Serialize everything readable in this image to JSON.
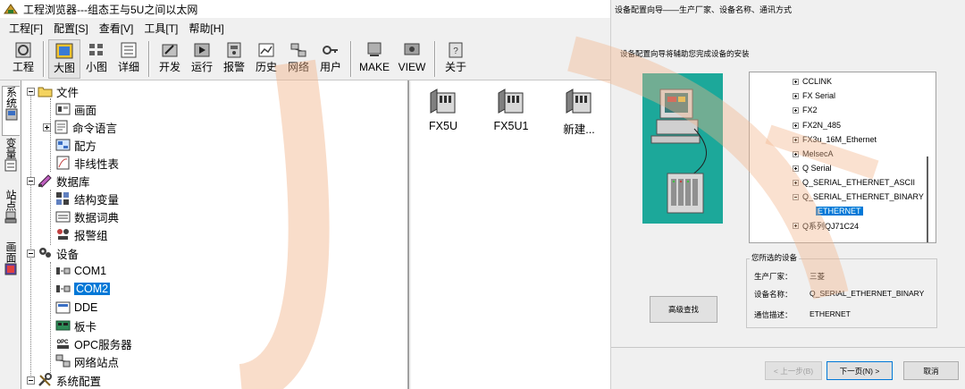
{
  "window": {
    "title": "工程浏览器---组态王与5U之间以太网"
  },
  "menu": [
    "工程[F]",
    "配置[S]",
    "查看[V]",
    "工具[T]",
    "帮助[H]"
  ],
  "toolbar": {
    "project": "工程",
    "large_icon": "大图",
    "small_icon": "小图",
    "details": "详细",
    "develop": "开发",
    "run": "运行",
    "alarm": "报警",
    "history": "历史",
    "network": "网络",
    "user": "用户",
    "make": "MAKE",
    "view": "VIEW",
    "about": "关于"
  },
  "side_tabs": [
    "系统",
    "变量",
    "站点",
    "画面"
  ],
  "tree": {
    "file": "文件",
    "screen": "画面",
    "command_lang": "命令语言",
    "recipe": "配方",
    "nonlinear": "非线性表",
    "database": "数据库",
    "struct_var": "结构变量",
    "data_dict": "数据词典",
    "alarm_group": "报警组",
    "device": "设备",
    "com1": "COM1",
    "com2": "COM2",
    "dde": "DDE",
    "board": "板卡",
    "opc": "OPC服务器",
    "net_station": "网络站点",
    "sys_config": "系统配置"
  },
  "list_items": [
    "FX5U",
    "FX5U1",
    "新建..."
  ],
  "dialog": {
    "title": "设备配置向导——生产厂家、设备名称、通讯方式",
    "intro": "设备配置向导将辅助您完成设备的安装",
    "device_list": [
      {
        "label": "CCLINK",
        "expanded": false
      },
      {
        "label": "FX Serial",
        "expanded": false
      },
      {
        "label": "FX2",
        "expanded": false
      },
      {
        "label": "FX2N_485",
        "expanded": false
      },
      {
        "label": "FX3u_16M_Ethernet",
        "expanded": false
      },
      {
        "label": "MelsecA",
        "expanded": false
      },
      {
        "label": "Q Serial",
        "expanded": false
      },
      {
        "label": "Q_SERIAL_ETHERNET_ASCII",
        "expanded": false
      },
      {
        "label": "Q_SERIAL_ETHERNET_BINARY",
        "expanded": true
      },
      {
        "label": "ETHERNET",
        "expanded": null
      },
      {
        "label": "Q系列QJ71C24",
        "expanded": false
      }
    ],
    "selected_group_title": "您所选的设备",
    "manufacturer_label": "生产厂家：",
    "manufacturer_value": "三菱",
    "device_name_label": "设备名称：",
    "device_name_value": "Q_SERIAL_ETHERNET_BINARY",
    "comm_desc_label": "通信描述：",
    "comm_desc_value": "ETHERNET",
    "advanced_search": "高级查找",
    "back": "< 上一步(B)",
    "next": "下一页(N) >",
    "cancel": "取消"
  }
}
